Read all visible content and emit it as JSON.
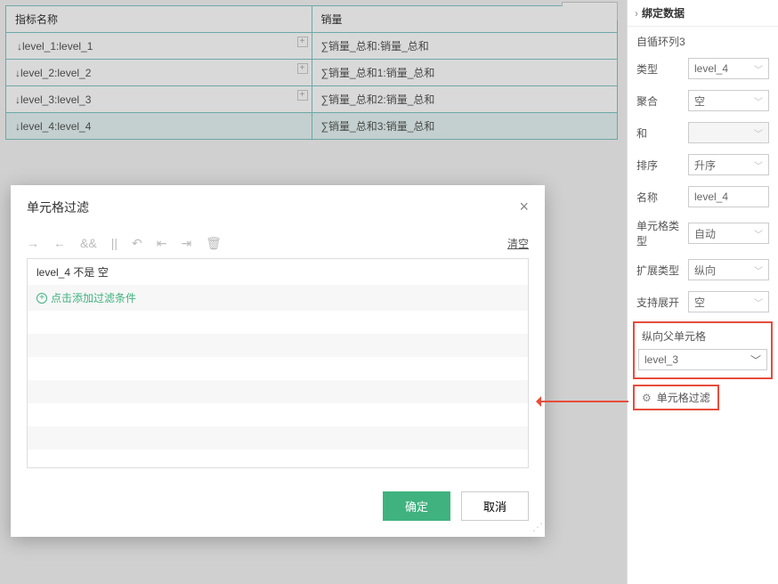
{
  "table": {
    "headers": [
      "指标名称",
      "销量"
    ],
    "rows": [
      {
        "left": "↓level_1:level_1",
        "right": "∑销量_总和:销量_总和"
      },
      {
        "left": "↓level_2:level_2",
        "right": "∑销量_总和1:销量_总和"
      },
      {
        "left": "↓level_3:level_3",
        "right": "∑销量_总和2:销量_总和"
      },
      {
        "left": "↓level_4:level_4",
        "right": "∑销量_总和3:销量_总和"
      }
    ]
  },
  "sidebar": {
    "title": "绑定数据",
    "subtitle": "自循环列3",
    "type": {
      "label": "类型",
      "value": "level_4"
    },
    "agg": {
      "label": "聚合",
      "value": "空"
    },
    "and": {
      "label": "和",
      "value": ""
    },
    "sort": {
      "label": "排序",
      "value": "升序"
    },
    "name": {
      "label": "名称",
      "value": "level_4"
    },
    "celltype": {
      "label": "单元格类型",
      "value": "自动"
    },
    "expandtype": {
      "label": "扩展类型",
      "value": "纵向"
    },
    "supportexpand": {
      "label": "支持展开",
      "value": "空"
    },
    "vparent": {
      "label": "纵向父单元格",
      "value": "level_3"
    },
    "filter_btn": "单元格过滤"
  },
  "modal": {
    "title": "单元格过滤",
    "clear": "清空",
    "rows": [
      "level_4 不是 空"
    ],
    "add_row": "点击添加过滤条件",
    "ok": "确定",
    "cancel": "取消"
  }
}
